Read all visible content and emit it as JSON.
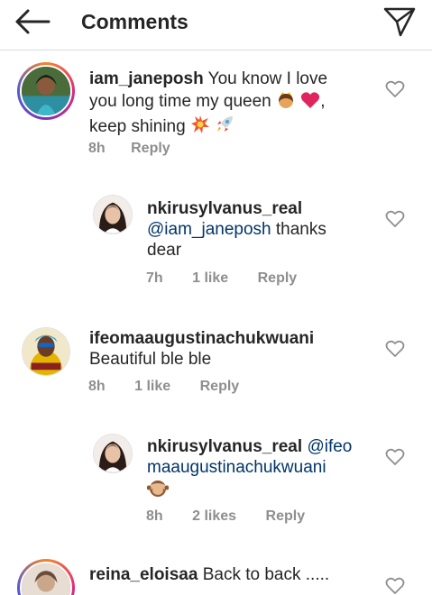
{
  "header": {
    "title": "Comments"
  },
  "comments": [
    {
      "username": "iam_janeposh",
      "text_1": "You know I love",
      "text_2": "you long time my queen",
      "text_3": ",",
      "text_4": "keep shining",
      "time": "8h",
      "reply": "Reply"
    },
    {
      "username": "nkirusylvanus_real",
      "mention": "@iam_janeposh",
      "text_1": "thanks",
      "text_2": "dear",
      "time": "7h",
      "likes": "1 like",
      "reply": "Reply"
    },
    {
      "username": "ifeomaaugustinachukwuani",
      "text_1": "Beautiful ble ble",
      "time": "8h",
      "likes": "1 like",
      "reply": "Reply"
    },
    {
      "username": "nkirusylvanus_real",
      "mention_1": "@ifeo",
      "mention_2": "maaugustinachukwuani",
      "time": "8h",
      "likes": "2 likes",
      "reply": "Reply"
    },
    {
      "username": "reina_eloisaa",
      "text_1": "Back to back ....."
    }
  ],
  "colors": {
    "text": "#262626",
    "meta": "#8e8e8e",
    "mention": "#003569"
  }
}
